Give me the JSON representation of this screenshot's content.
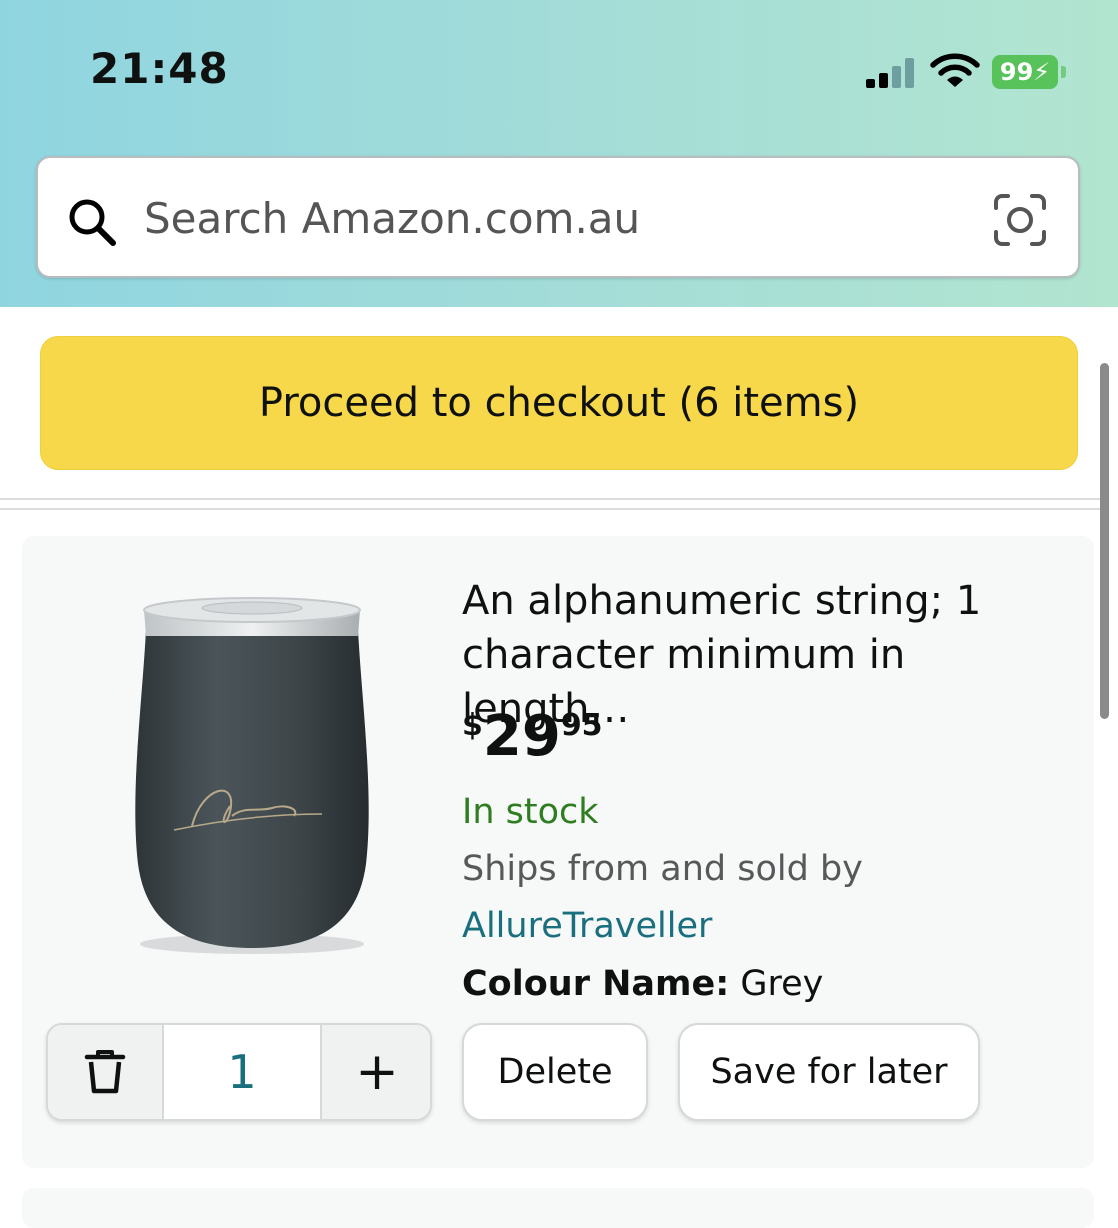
{
  "status_bar": {
    "time": "21:48",
    "battery": "99⚡"
  },
  "search": {
    "placeholder": "Search Amazon.com.au"
  },
  "checkout": {
    "label": "Proceed to checkout (6 items)"
  },
  "cart_item": {
    "title": "An alphanumeric string; 1 character minimum in length…",
    "price_symbol": "$",
    "price_whole": "29",
    "price_fraction": "95",
    "stock": "In stock",
    "ships_text": "Ships from and sold by",
    "seller": "AllureTraveller",
    "colour_label": "Colour Name:",
    "colour_value": "Grey",
    "quantity": "1",
    "plus_label": "+",
    "delete_label": "Delete",
    "save_label": "Save for later",
    "brand_logo_text": "Allure TRAVELLER"
  },
  "colors": {
    "checkout_yellow": "#f6d84a",
    "stock_green": "#2f7d21",
    "link_teal": "#1a6f7f"
  }
}
